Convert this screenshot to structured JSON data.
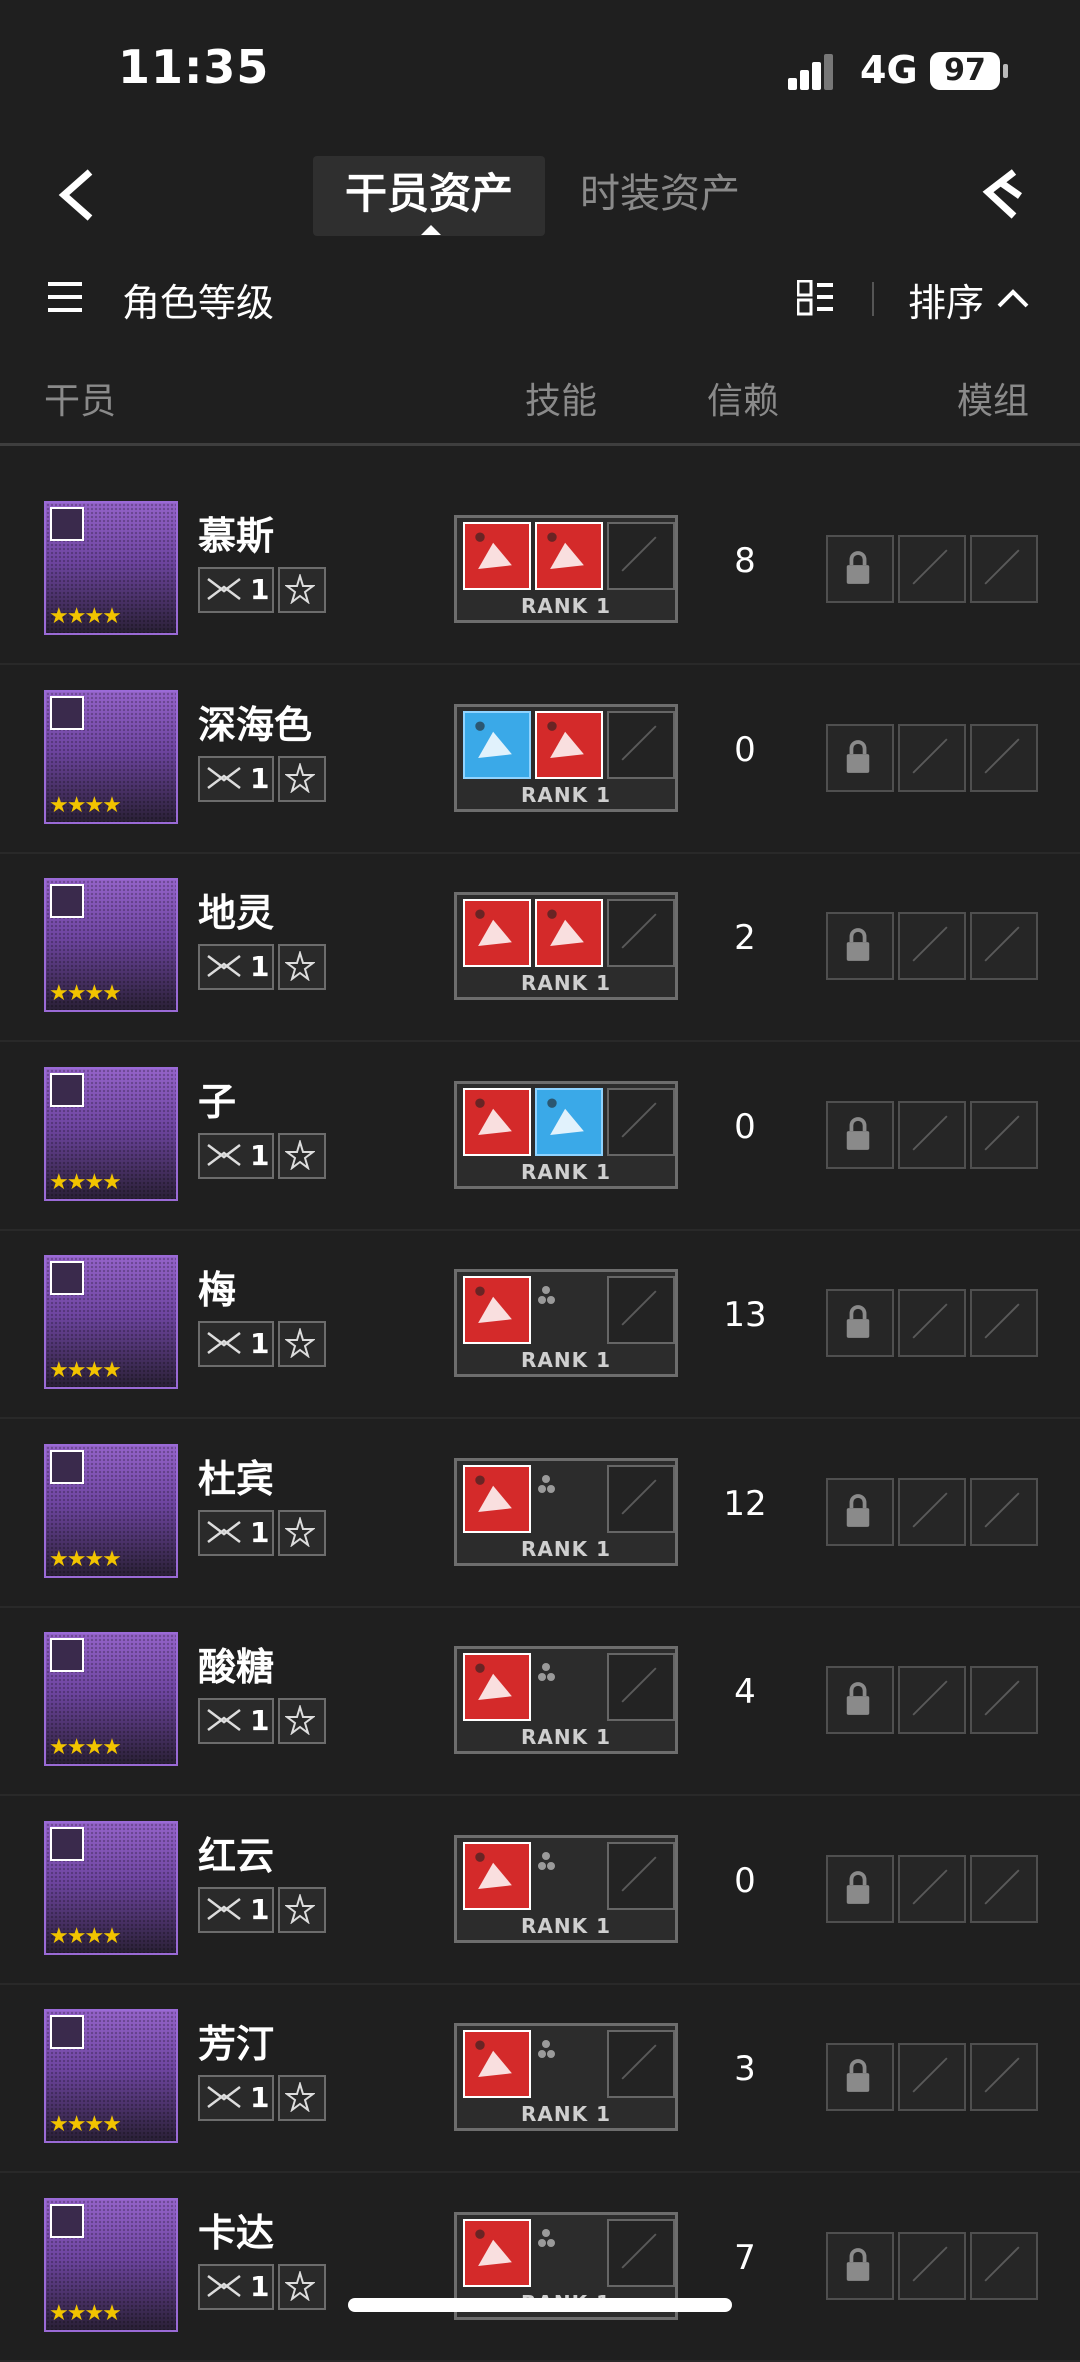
{
  "status_bar": {
    "time": "11:35",
    "network": "4G",
    "battery": "97"
  },
  "nav": {
    "tab_active": "干员资产",
    "tab_inactive": "时装资产"
  },
  "toolbar": {
    "sort_mode": "角色等级",
    "sort_label": "排序"
  },
  "columns": {
    "operator": "干员",
    "skills": "技能",
    "trust": "信赖",
    "modules": "模组"
  },
  "rank_text": {
    "prefix": "RANK",
    "level": "1"
  },
  "colors": {
    "background": "#1f1f1f",
    "portrait_border": "#9a6ad6",
    "skill_red": "#d42a2a",
    "skill_blue": "#3aa9e8",
    "star": "#f2c400"
  },
  "operators": [
    {
      "name": "慕斯",
      "class_icon": "guard-icon",
      "stars": "★★★★",
      "elite": "1",
      "trust": "8",
      "skills": [
        "red",
        "red"
      ]
    },
    {
      "name": "深海色",
      "class_icon": "supporter-icon",
      "stars": "★★★★",
      "elite": "1",
      "trust": "0",
      "skills": [
        "blue",
        "red"
      ]
    },
    {
      "name": "地灵",
      "class_icon": "supporter-icon",
      "stars": "★★★★",
      "elite": "1",
      "trust": "2",
      "skills": [
        "red",
        "red"
      ]
    },
    {
      "name": "子",
      "class_icon": "medic-icon",
      "stars": "★★★★",
      "elite": "1",
      "trust": "0",
      "skills": [
        "red",
        "blue"
      ]
    },
    {
      "name": "梅",
      "class_icon": "sniper-icon",
      "stars": "★★★★",
      "elite": "1",
      "trust": "13",
      "skills": [
        "red"
      ]
    },
    {
      "name": "杜宾",
      "class_icon": "guard-icon",
      "stars": "★★★★",
      "elite": "1",
      "trust": "12",
      "skills": [
        "red"
      ]
    },
    {
      "name": "酸糖",
      "class_icon": "sniper-icon",
      "stars": "★★★★",
      "elite": "1",
      "trust": "4",
      "skills": [
        "red"
      ]
    },
    {
      "name": "红云",
      "class_icon": "sniper-icon",
      "stars": "★★★★",
      "elite": "1",
      "trust": "0",
      "skills": [
        "red"
      ]
    },
    {
      "name": "芳汀",
      "class_icon": "guard-icon",
      "stars": "★★★★",
      "elite": "1",
      "trust": "3",
      "skills": [
        "red"
      ]
    },
    {
      "name": "卡达",
      "class_icon": "caster-icon",
      "stars": "★★★★",
      "elite": "1",
      "trust": "7",
      "skills": [
        "red"
      ]
    }
  ]
}
